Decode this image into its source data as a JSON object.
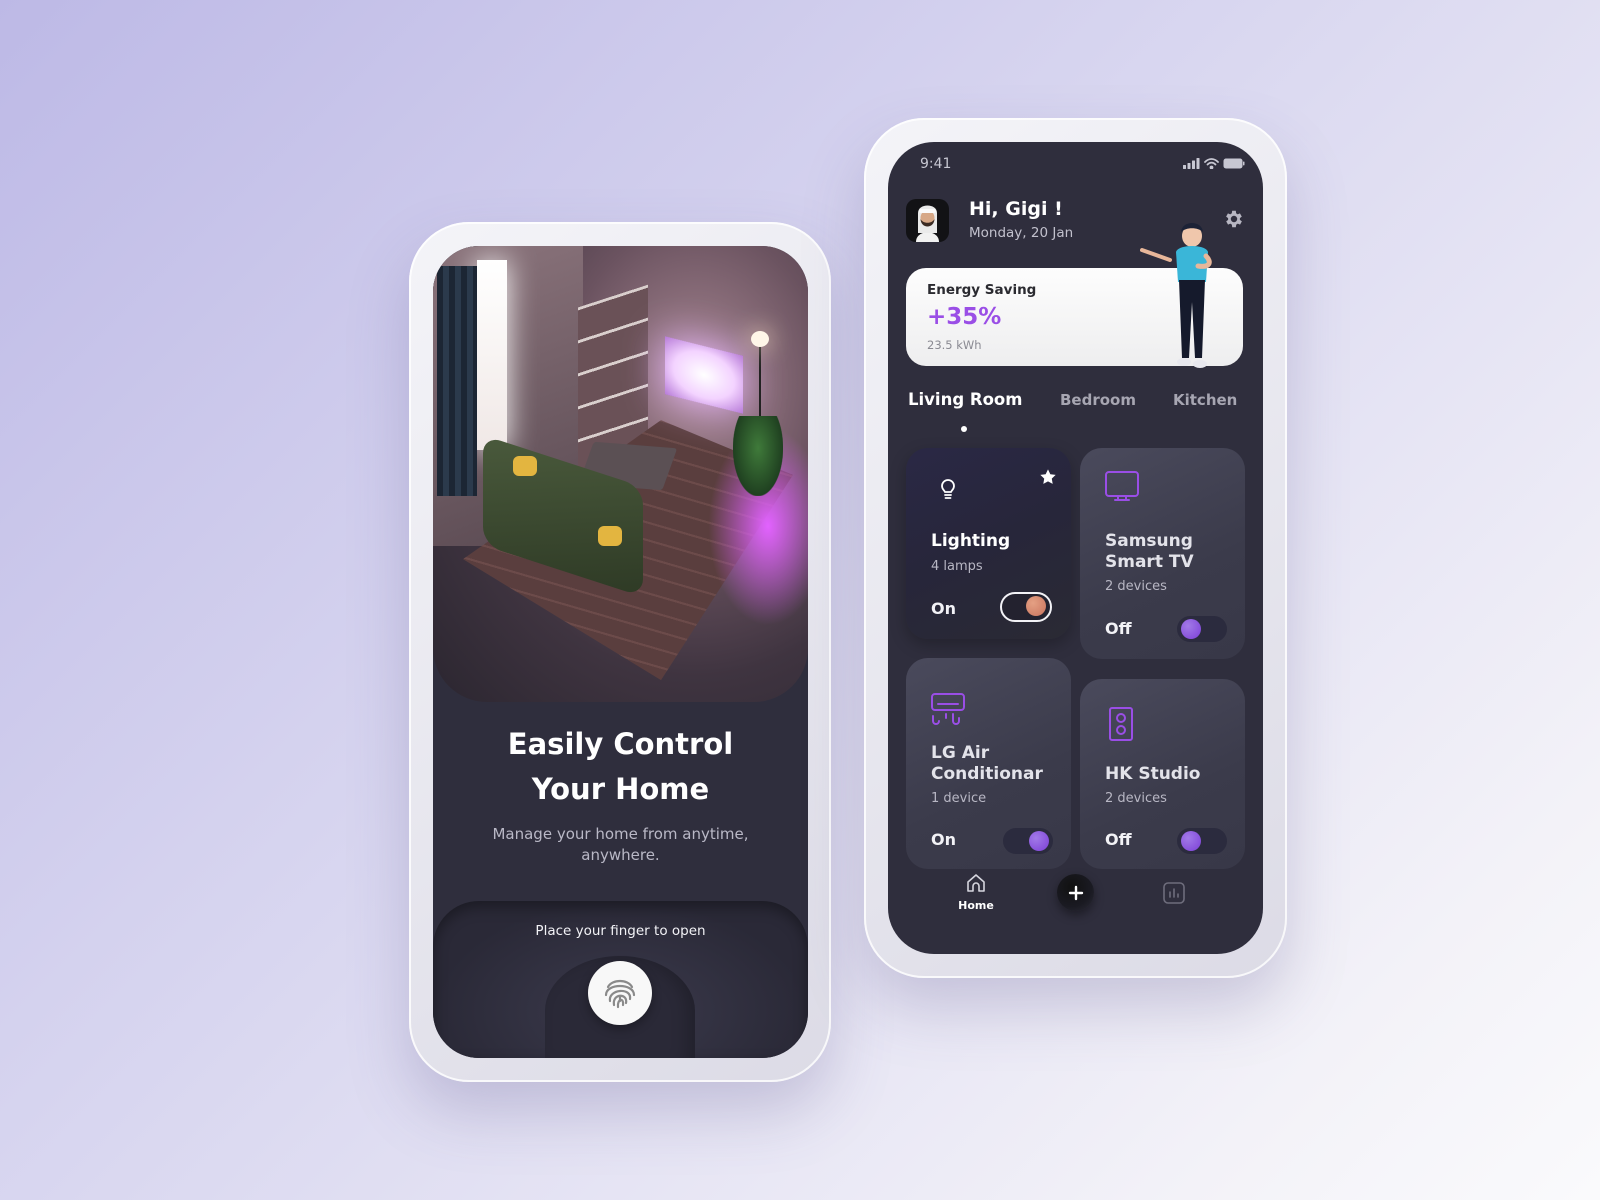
{
  "onboarding": {
    "title_line1": "Easily Control",
    "title_line2": "Your Home",
    "subtitle": "Manage your home from anytime, anywhere.",
    "fingerprint_prompt": "Place your finger to open",
    "icons": {
      "fingerprint": "fingerprint-icon"
    }
  },
  "dashboard": {
    "status_bar": {
      "time": "9:41",
      "icons": [
        "signal-icon",
        "wifi-icon",
        "battery-icon"
      ]
    },
    "header": {
      "greeting": "Hi, Gigi !",
      "date": "Monday, 20 Jan",
      "settings_icon": "gear-icon"
    },
    "energy_card": {
      "label": "Energy Saving",
      "value": "+35%",
      "usage": "23.5 kWh"
    },
    "tabs": [
      {
        "label": "Living Room",
        "active": true
      },
      {
        "label": "Bedroom",
        "active": false
      },
      {
        "label": "Kitchen",
        "active": false
      }
    ],
    "devices": [
      {
        "name": "Lighting",
        "count": "4 lamps",
        "state": "On",
        "on": true,
        "favorite": true,
        "icon": "lightbulb-icon"
      },
      {
        "name": "Samsung Smart TV",
        "count": "2 devices",
        "state": "Off",
        "on": false,
        "favorite": false,
        "icon": "tv-icon"
      },
      {
        "name": "LG Air Conditionar",
        "count": "1 device",
        "state": "On",
        "on": true,
        "favorite": false,
        "icon": "air-conditioner-icon"
      },
      {
        "name": "HK Studio",
        "count": "2 devices",
        "state": "Off",
        "on": false,
        "favorite": false,
        "icon": "speaker-icon"
      }
    ],
    "bottom_nav": {
      "home_label": "Home",
      "items": [
        "home-icon",
        "plus-icon",
        "chart-icon"
      ]
    },
    "colors": {
      "accent": "#9a4ee6",
      "screen_bg": "#2f2e3d",
      "card_bg": "#44445a",
      "toggle_knob": "#8a55dd",
      "lighting_knob": "#d98a70"
    }
  }
}
